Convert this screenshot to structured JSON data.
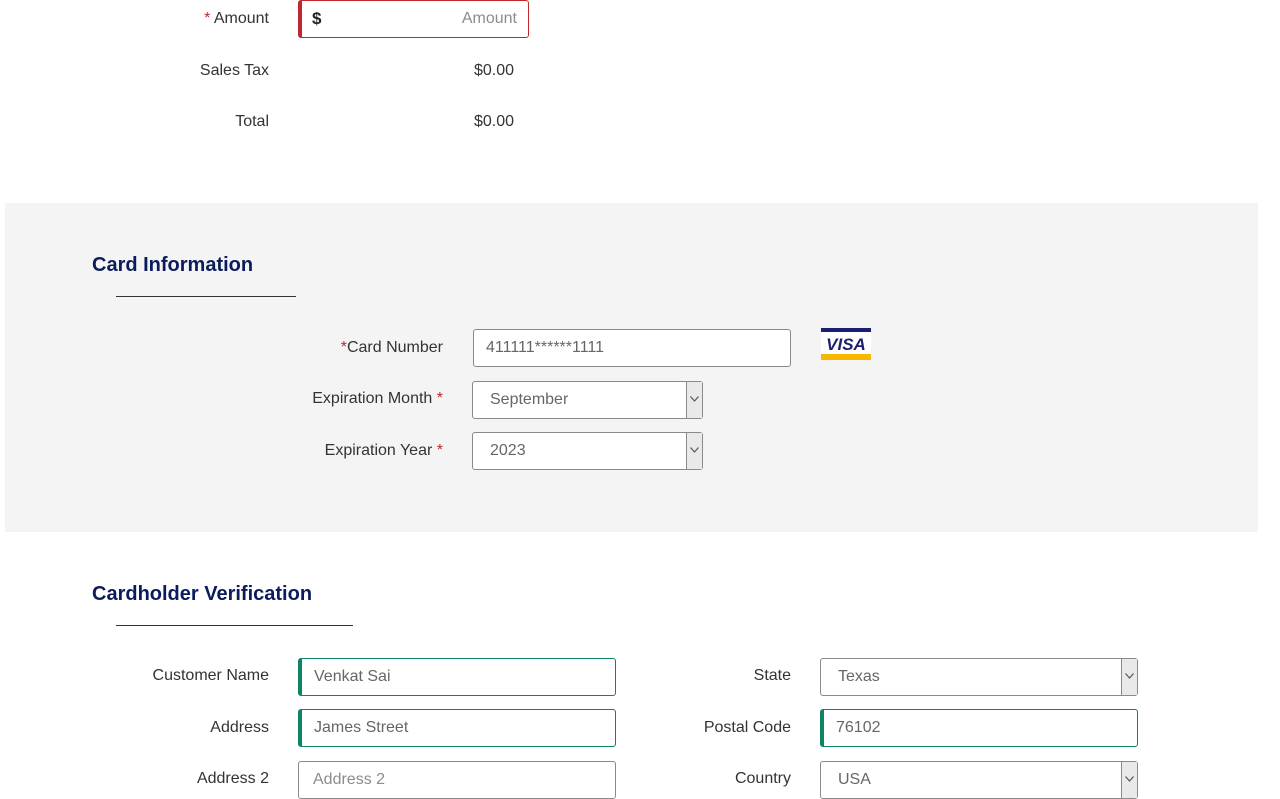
{
  "payment": {
    "amount_label": "Amount",
    "required_mark": "*",
    "amount_currency": "$",
    "amount_placeholder": "Amount",
    "sales_tax_label": "Sales Tax",
    "sales_tax_value": "$0.00",
    "total_label": "Total",
    "total_value": "$0.00"
  },
  "card_info": {
    "title": "Card Information",
    "card_number_label": "Card Number",
    "card_number_value": "411111******1111",
    "card_brand": "VISA",
    "exp_month_label": "Expiration Month",
    "exp_month_value": "September",
    "exp_year_label": "Expiration Year",
    "exp_year_value": "2023"
  },
  "verification": {
    "title": "Cardholder Verification",
    "customer_name_label": "Customer Name",
    "customer_name_value": "Venkat Sai",
    "address_label": "Address",
    "address_value": "James Street",
    "address2_label": "Address 2",
    "address2_placeholder": "Address 2",
    "state_label": "State",
    "state_value": "Texas",
    "postal_label": "Postal Code",
    "postal_value": "76102",
    "country_label": "Country",
    "country_value": "USA"
  },
  "colors": {
    "error": "#c0272d",
    "valid": "#0d8466",
    "heading": "#0b1c5c",
    "section_bg": "#f4f4f4",
    "visa_blue": "#1a1f71",
    "visa_gold": "#f7b600"
  }
}
